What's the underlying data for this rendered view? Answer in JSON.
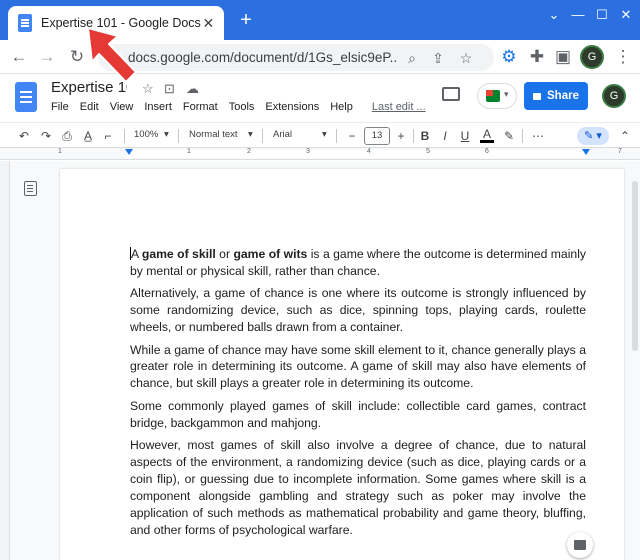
{
  "browser": {
    "tab_title": "Expertise 101 - Google Docs",
    "new_tab": "+",
    "url": "docs.google.com/document/d/1Gs_elsic9eP...",
    "avatar_initial": "G"
  },
  "docs": {
    "title": "Expertise 101",
    "menu": [
      "File",
      "Edit",
      "View",
      "Insert",
      "Format",
      "Tools",
      "Extensions",
      "Help"
    ],
    "last_edit": "Last edit ...",
    "share_label": "Share",
    "avatar_initial": "G"
  },
  "toolbar": {
    "zoom": "100%",
    "style": "Normal text",
    "font": "Arial",
    "font_size": "13",
    "minus": "−",
    "plus": "+",
    "bold": "B",
    "italic": "I",
    "underline": "U",
    "text_color": "A",
    "more": "⋯"
  },
  "ruler": {
    "numbers": [
      "1",
      "1",
      "2",
      "3",
      "4",
      "5",
      "6",
      "7"
    ]
  },
  "document": {
    "p1": {
      "lead": "A ",
      "bold1": "game of skill",
      "mid": " or ",
      "bold2": "game of wits",
      "rest": " is a game where the outcome is determined mainly by mental or physical skill, rather than chance."
    },
    "p2": "Alternatively, a game of chance is one where its outcome is strongly influenced by some randomizing device, such as dice, spinning tops, playing cards, roulette wheels, or numbered balls drawn from a container.",
    "p3": "While a game of chance may have some skill element to it, chance generally plays a greater role in determining its outcome. A game of skill may also have elements of chance, but skill plays a greater role in determining its outcome.",
    "p4": "Some commonly played games of skill include: collectible card games, contract bridge, backgammon and mahjong.",
    "p5": "However, most games of skill also involve a degree of chance, due to natural aspects of the environment, a randomizing device (such as dice, playing cards or a coin flip), or guessing due to incomplete information. Some games where skill is a component alongside gambling and strategy such as poker may involve the application of such methods as mathematical probability and game theory, bluffing, and other forms of psychological warfare."
  },
  "colors": {
    "browser_accent": "#2b6fe0",
    "share_button": "#1a73e8",
    "annotation_arrow": "#e53935"
  }
}
